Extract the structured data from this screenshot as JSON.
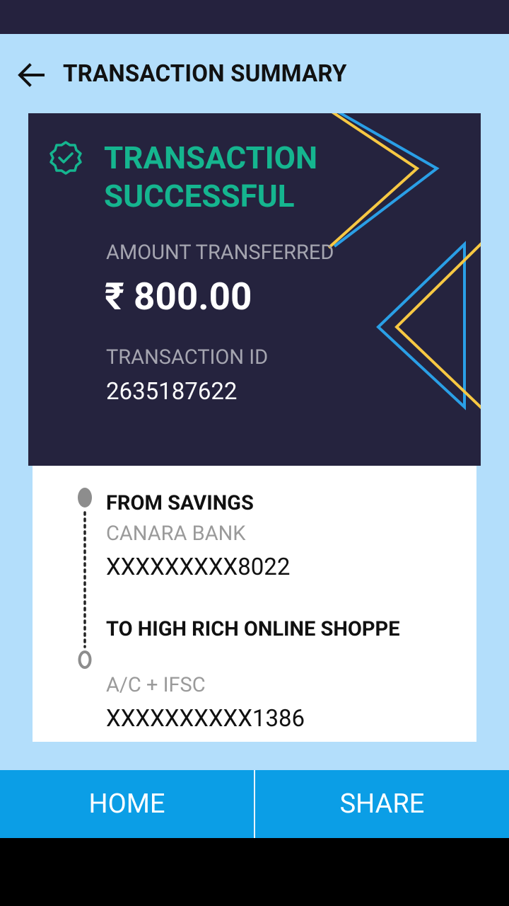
{
  "header": {
    "title": "TRANSACTION SUMMARY",
    "back_icon": "arrow-left-icon"
  },
  "hero": {
    "status": "TRANSACTION\nSUCCESSFUL",
    "status_icon": "check-badge-icon",
    "amount_label": "AMOUNT TRANSFERRED",
    "amount": "₹ 800.00",
    "txn_label": "TRANSACTION ID",
    "txn_id": "2635187622",
    "colors": {
      "background": "#25233e",
      "success": "#15b58f",
      "deco_yellow": "#f7c843",
      "deco_blue": "#2a9fe6"
    }
  },
  "details": {
    "from": {
      "title": "FROM SAVINGS",
      "bank": "CANARA BANK",
      "account": "XXXXXXXXX8022"
    },
    "to": {
      "title": "TO HIGH RICH ONLINE SHOPPE",
      "subtitle": "A/C + IFSC",
      "account": "XXXXXXXXXX1386"
    }
  },
  "actions": {
    "home": "HOME",
    "share": "SHARE",
    "color": "#0b9ee6"
  }
}
